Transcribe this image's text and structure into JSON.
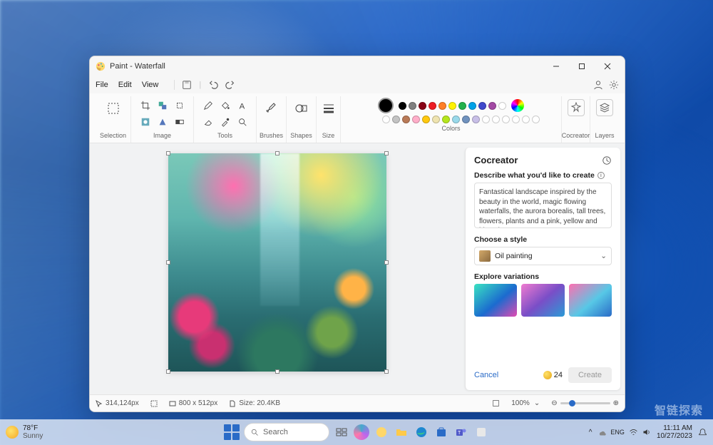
{
  "window": {
    "title": "Paint - Waterfall"
  },
  "menu": {
    "file": "File",
    "edit": "Edit",
    "view": "View"
  },
  "ribbon": {
    "selection": "Selection",
    "image": "Image",
    "tools": "Tools",
    "brushes": "Brushes",
    "shapes": "Shapes",
    "size": "Size",
    "colors": "Colors",
    "cocreator": "Cocreator",
    "layers": "Layers",
    "current_color": "#000000",
    "palette_row1": [
      "#000000",
      "#7f7f7f",
      "#880015",
      "#ed1c24",
      "#ff7f27",
      "#fff200",
      "#22b14c",
      "#00a2e8",
      "#3f48cc",
      "#a349a4",
      "#ffffff"
    ],
    "palette_row2": [
      "#ffffff",
      "#c3c3c3",
      "#b97a57",
      "#ffaec9",
      "#ffc90e",
      "#efe4b0",
      "#b5e61d",
      "#99d9ea",
      "#7092be",
      "#c8bfe7"
    ]
  },
  "cocreator": {
    "title": "Cocreator",
    "describe_label": "Describe what you'd like to create",
    "prompt": "Fantastical landscape inspired by the beauty in the world, magic flowing waterfalls, the aurora borealis, tall trees, flowers, plants and a pink, yellow and blue sky.",
    "choose_style": "Choose a style",
    "style": "Oil painting",
    "explore": "Explore variations",
    "cancel": "Cancel",
    "credits": "24",
    "create": "Create",
    "variation_bg": [
      "linear-gradient(140deg,#3ae3c2,#1b6bcf 55%,#e24ab2)",
      "linear-gradient(140deg,#f07bd0,#7a4ec7 50%,#2a9bd6)",
      "linear-gradient(140deg,#ff6fb0,#57c8e6 55%,#2a6bc7)"
    ]
  },
  "status": {
    "cursor": "314,124px",
    "dims": "800  x  512px",
    "size": "Size: 20.4KB",
    "zoom": "100%"
  },
  "taskbar": {
    "temp": "78°F",
    "cond": "Sunny",
    "search": "Search",
    "time": "11:11 AM",
    "date": "10/27/2023"
  },
  "watermark": "智链探索"
}
